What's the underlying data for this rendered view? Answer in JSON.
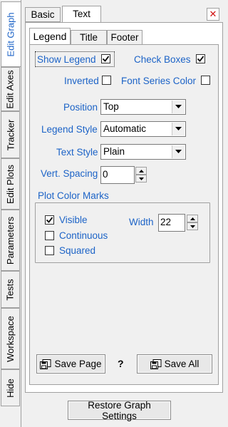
{
  "side_tabs": [
    "Edit Graph",
    "Edit Axes",
    "Tracker",
    "Edit Plots",
    "Parameters",
    "Tests",
    "Workspace",
    "Hide"
  ],
  "top_tabs": [
    "Basic",
    "Text"
  ],
  "close_glyph": "✕",
  "sub_tabs": [
    "Legend",
    "Title",
    "Footer"
  ],
  "legend": {
    "show_legend_label": "Show Legend",
    "show_legend_checked": true,
    "check_boxes_label": "Check Boxes",
    "check_boxes_checked": true,
    "inverted_label": "Inverted",
    "inverted_checked": false,
    "font_series_color_label": "Font Series Color",
    "font_series_color_checked": false,
    "position_label": "Position",
    "position_value": "Top",
    "legend_style_label": "Legend Style",
    "legend_style_value": "Automatic",
    "text_style_label": "Text Style",
    "text_style_value": "Plain",
    "vert_spacing_label": "Vert. Spacing",
    "vert_spacing_value": "0"
  },
  "plot_color_marks": {
    "title": "Plot Color Marks",
    "visible_label": "Visible",
    "visible_checked": true,
    "continuous_label": "Continuous",
    "continuous_checked": false,
    "squared_label": "Squared",
    "squared_checked": false,
    "width_label": "Width",
    "width_value": "22"
  },
  "buttons": {
    "save_page": "Save Page",
    "help": "?",
    "save_all": "Save All",
    "restore": "Restore Graph Settings"
  },
  "colors": {
    "accent_text": "#1c63c7",
    "close_red": "#d01010"
  }
}
